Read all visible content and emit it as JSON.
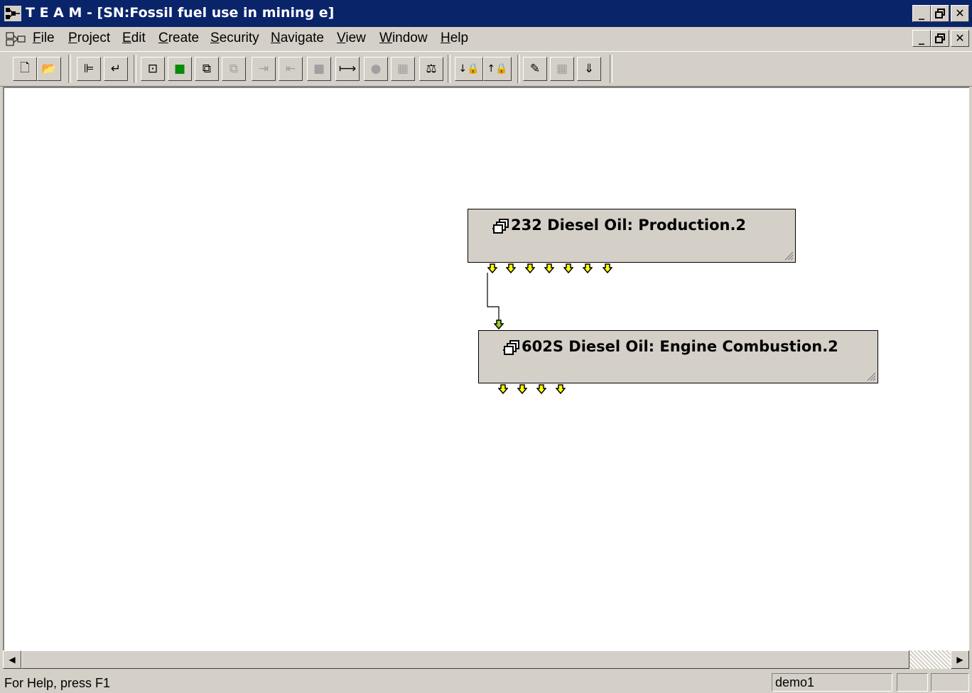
{
  "window": {
    "title": "T E A M - [SN:Fossil fuel use in mining e]",
    "controls": [
      "_",
      "🗗",
      "✕"
    ]
  },
  "menubar": {
    "items": [
      {
        "label": "File",
        "mnemonic": "F",
        "rest": "ile"
      },
      {
        "label": "Project",
        "mnemonic": "P",
        "rest": "roject"
      },
      {
        "label": "Edit",
        "mnemonic": "E",
        "rest": "dit"
      },
      {
        "label": "Create",
        "mnemonic": "C",
        "rest": "reate"
      },
      {
        "label": "Security",
        "mnemonic": "S",
        "rest": "ecurity"
      },
      {
        "label": "Navigate",
        "mnemonic": "N",
        "rest": "avigate"
      },
      {
        "label": "View",
        "mnemonic": "V",
        "rest": "iew"
      },
      {
        "label": "Window",
        "mnemonic": "W",
        "rest": "indow"
      },
      {
        "label": "Help",
        "mnemonic": "H",
        "rest": "elp"
      }
    ]
  },
  "toolbar": {
    "buttons": [
      {
        "icon": "new-document-icon",
        "glyph": "🗋",
        "enabled": true
      },
      {
        "icon": "open-folder-icon",
        "glyph": "📂",
        "enabled": true
      },
      {
        "icon": "tree-view-icon",
        "glyph": "⊫",
        "enabled": true
      },
      {
        "icon": "return-arrow-icon",
        "glyph": "↵",
        "enabled": true
      },
      {
        "icon": "subsystem-icon",
        "glyph": "⊡",
        "enabled": true
      },
      {
        "icon": "module-green-icon",
        "glyph": "■",
        "enabled": true
      },
      {
        "icon": "stacked-modules-icon",
        "glyph": "⧉",
        "enabled": true
      },
      {
        "icon": "stacked-modules-disabled-icon",
        "glyph": "⧉",
        "enabled": false
      },
      {
        "icon": "link-in-icon",
        "glyph": "⇥",
        "enabled": false
      },
      {
        "icon": "link-out-icon",
        "glyph": "⇤",
        "enabled": false
      },
      {
        "icon": "block-icon",
        "glyph": "■",
        "enabled": false
      },
      {
        "icon": "connect-icon",
        "glyph": "⟼",
        "enabled": true
      },
      {
        "icon": "sphere-icon",
        "glyph": "●",
        "enabled": false
      },
      {
        "icon": "calculator-icon",
        "glyph": "▦",
        "enabled": false
      },
      {
        "icon": "balance-scale-icon",
        "glyph": "⚖",
        "enabled": true
      },
      {
        "icon": "lock-down-icon",
        "glyph": "↓🔒",
        "enabled": true
      },
      {
        "icon": "lock-up-icon",
        "glyph": "↑🔒",
        "enabled": true
      },
      {
        "icon": "edit-table-icon",
        "glyph": "✎",
        "enabled": true
      },
      {
        "icon": "grid-icon",
        "glyph": "▦",
        "enabled": false
      },
      {
        "icon": "download-arrow-icon",
        "glyph": "⇓",
        "enabled": true
      }
    ]
  },
  "diagram": {
    "nodes": [
      {
        "id": "232",
        "label": "232 Diesel Oil: Production.2",
        "icon": "module-stack-icon"
      },
      {
        "id": "602S",
        "label": "602S Diesel Oil: Engine Combustion.2",
        "icon": "module-stack-icon"
      }
    ],
    "connections": [
      {
        "from": "232",
        "to": "602S"
      }
    ],
    "port_color": "#ffff00"
  },
  "statusbar": {
    "help_text": "For Help, press F1",
    "user": "demo1"
  }
}
